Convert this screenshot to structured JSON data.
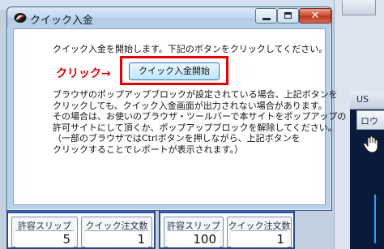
{
  "dialog": {
    "title": "クイック入金",
    "intro": "クイック入金を開始します。下記のボタンをクリックしてください。",
    "click_label": "クリック→",
    "button_label": "クイック入金開始",
    "description": [
      "ブラウザのポップアップブロックが設定されている場合、上記ボタンを",
      "クリックしても、クイック入金画面が出力されない場合があります。",
      "その場合は、お使いのブラウザ・ツールバーで本サイトをポップアップの",
      "許可サイトにして頂くか、ポップアップブロックを解除してください。",
      "（一部のブラウザではCtrlボタンを押しながら、上記ボタンを",
      "クリックすることでレポートが表示されます。）"
    ],
    "close_glyph": "✕"
  },
  "background": {
    "chart_tab": "US",
    "chart_subtab": "ロウ"
  },
  "orders": [
    {
      "slippage_label": "許容スリップ",
      "slippage_value": "5",
      "qty_label": "クイック注文数",
      "qty_value": "1"
    },
    {
      "slippage_label": "許容スリップ",
      "slippage_value": "100",
      "qty_label": "クイック注文数",
      "qty_value": "1"
    }
  ],
  "colors": {
    "accent_red": "#e00000",
    "panel_blue": "#2a4a86"
  }
}
